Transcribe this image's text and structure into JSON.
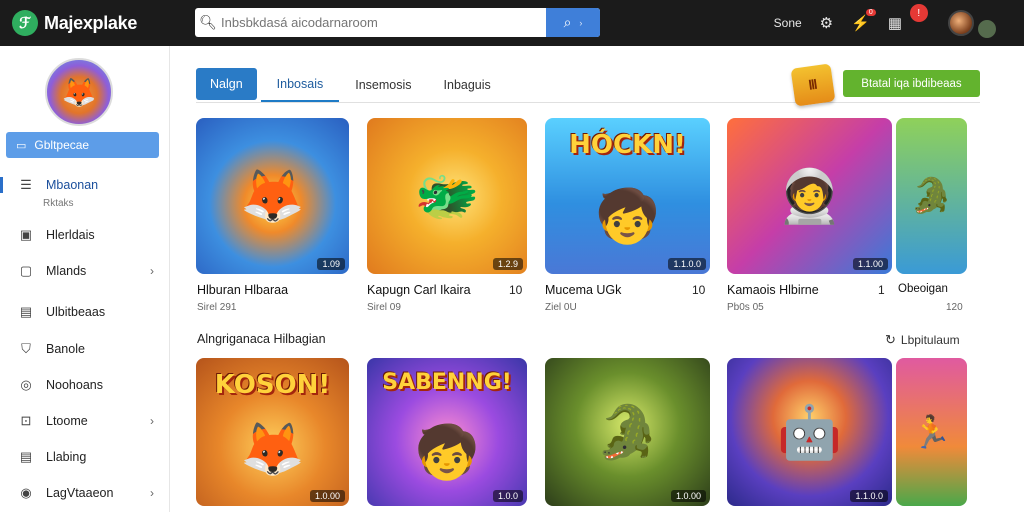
{
  "app": {
    "name": "Majexplake",
    "logo_icon": "leaf-logo-icon"
  },
  "search": {
    "placeholder": "Inbsbkdasá aicodarnaroom",
    "value": ""
  },
  "topbar": {
    "link_label": "Sone",
    "badge_count": "0",
    "notifications_badge": "!"
  },
  "sidebar": {
    "active_label": "Gbltpecae",
    "items": [
      {
        "label": "Mbaonan",
        "sub": "Rktaks",
        "icon": "window-icon"
      },
      {
        "label": "Hlerldais",
        "icon": "grid-icon"
      },
      {
        "label": "Mlands",
        "icon": "image-icon",
        "has_chevron": true
      },
      {
        "label": "Ulbitbeaas",
        "icon": "document-icon"
      },
      {
        "label": "Banole",
        "icon": "shield-icon"
      },
      {
        "label": "Noohoans",
        "icon": "target-icon"
      },
      {
        "label": "Ltoome",
        "icon": "lock-icon",
        "has_chevron": true
      },
      {
        "label": "Llabing",
        "icon": "list-icon"
      },
      {
        "label": "LagVtaaeon",
        "icon": "user-icon",
        "has_chevron": true
      }
    ]
  },
  "tabs": [
    "Nalgn",
    "Inbosais",
    "Insemosis",
    "Inbaguis"
  ],
  "promo": {
    "badge_text": "Ⅲ",
    "cta_label": "Btatal iqa ibdibeaas"
  },
  "games_row1": [
    {
      "title": "Hlburan Hlbaraa",
      "meta": "Sirel 291",
      "overlay": "1.09",
      "num": ""
    },
    {
      "title": "Kapugn Carl Ikaira",
      "meta": "Sirel 09",
      "overlay": "1.2.9",
      "num": "10"
    },
    {
      "title": "Mucema UGk",
      "meta": "Ziel 0U",
      "overlay": "1.1.0.0",
      "num": "10",
      "art_title": "HÓCKN!"
    },
    {
      "title": "Kamaois Hlbirne",
      "meta": "Pb0s 05",
      "overlay": "1.1.00",
      "num": "1"
    },
    {
      "title": "Obeoigan",
      "meta": "120",
      "overlay": "",
      "num": ""
    }
  ],
  "section": {
    "title": "Alngriganaca Hilbagian",
    "link_label": "Lbpitulaum"
  },
  "games_row2": [
    {
      "overlay": "1.0.00",
      "art_title": "KOSON!"
    },
    {
      "overlay": "1.0.0",
      "art_title": "SABENNG!"
    },
    {
      "overlay": "1.0.00",
      "art_title": ""
    },
    {
      "overlay": "1.1.0.0",
      "art_title": ""
    },
    {
      "overlay": "",
      "art_title": ""
    }
  ],
  "colors": {
    "topbar": "#1b1b1b",
    "accent_blue": "#2a7bc6",
    "cta_green": "#63b32e",
    "sidebar_active": "#5d9de8"
  }
}
